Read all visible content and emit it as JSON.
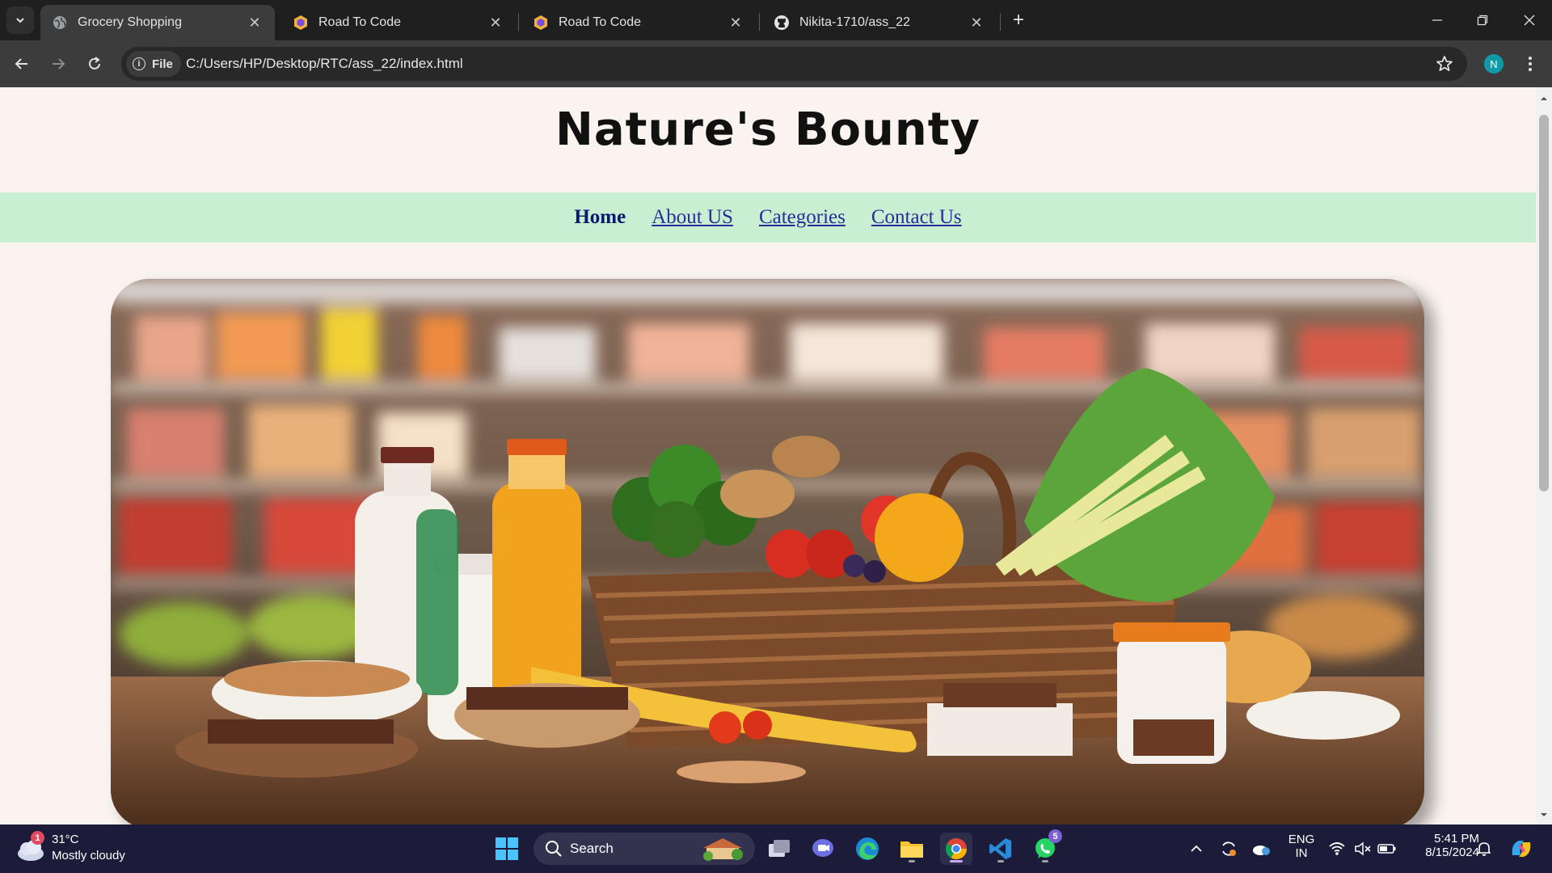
{
  "browser": {
    "tabs": [
      {
        "title": "Grocery Shopping",
        "icon": "globe-icon",
        "active": true
      },
      {
        "title": "Road To Code",
        "icon": "road-to-code-icon",
        "active": false
      },
      {
        "title": "Road To Code",
        "icon": "road-to-code-icon",
        "active": false
      },
      {
        "title": "Nikita-1710/ass_22",
        "icon": "github-icon",
        "active": false
      }
    ],
    "address": {
      "chip_label": "File",
      "url": "C:/Users/HP/Desktop/RTC/ass_22/index.html"
    },
    "profile_initial": "N"
  },
  "page": {
    "title": "Nature's Bounty",
    "nav": [
      "Home",
      "About US",
      "Categories",
      "Contact Us"
    ],
    "hero_image": "grocery-basket-hero-image"
  },
  "taskbar": {
    "weather": {
      "temp": "31°C",
      "condition": "Mostly cloudy",
      "badge": "1"
    },
    "search_label": "Search",
    "whatsapp_badge": "5",
    "language": {
      "line1": "ENG",
      "line2": "IN"
    },
    "clock": {
      "time": "5:41 PM",
      "date": "8/15/2024"
    }
  },
  "colors": {
    "tabstrip": "#1f1f1f",
    "toolbar": "#3c3c3c",
    "page_bg": "#faf3ef",
    "nav_bg": "#c8efd2",
    "nav_link": "#2b2b9c",
    "taskbar": "#1c1c3a"
  }
}
